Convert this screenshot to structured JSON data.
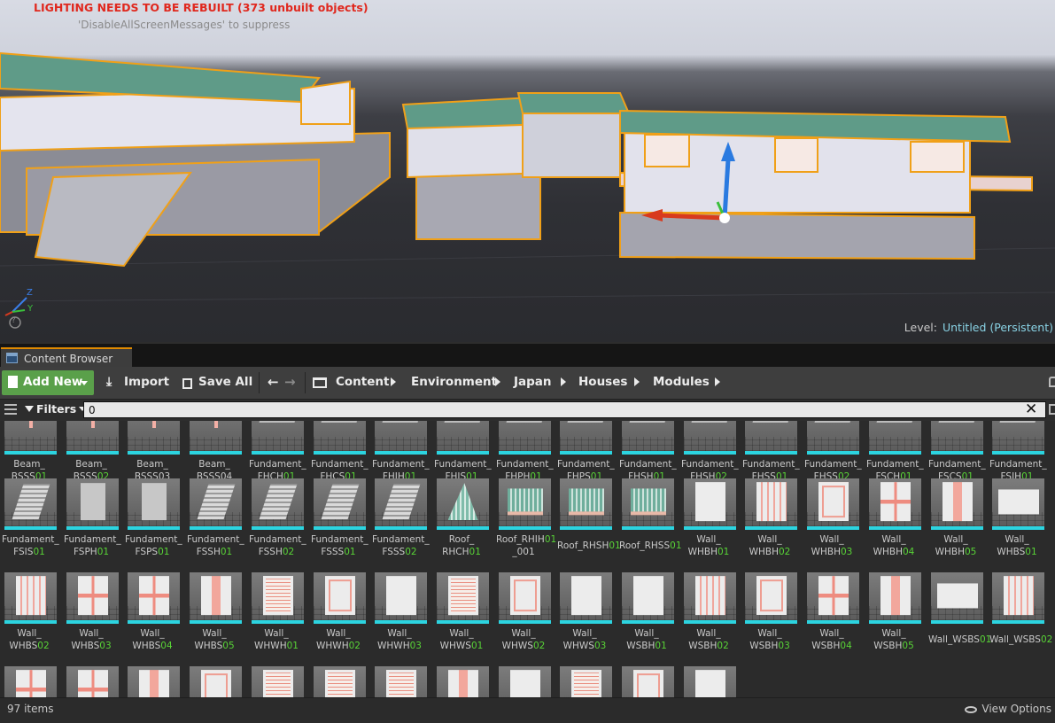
{
  "viewport": {
    "warning": "LIGHTING NEEDS TO BE REBUILT (373 unbuilt objects)",
    "warning_hint": "'DisableAllScreenMessages' to suppress",
    "level_label": "Level:",
    "level_value": "Untitled (Persistent)",
    "axis_z": "Z",
    "axis_y": "Y",
    "help": "?"
  },
  "tab": {
    "label": "Content Browser"
  },
  "toolbar": {
    "add_new": "Add New",
    "import": "Import",
    "save_all": "Save All",
    "back": "←",
    "forward": "→",
    "breadcrumbs": [
      "Content",
      "Environment",
      "Japan",
      "Houses",
      "Modules"
    ]
  },
  "filter": {
    "label": "Filters",
    "search_value": "0",
    "clear": "✕"
  },
  "assets": {
    "rows": [
      [
        {
          "pre": "Beam_",
          "mid": "BSSS",
          "hl": "01",
          "post": "",
          "kind": "beam"
        },
        {
          "pre": "Beam_",
          "mid": "BSSS",
          "hl": "02",
          "post": "",
          "kind": "beam"
        },
        {
          "pre": "Beam_",
          "mid": "BSSS03",
          "hl": "",
          "post": "",
          "kind": "beam"
        },
        {
          "pre": "Beam_",
          "mid": "BSSS04",
          "hl": "",
          "post": "",
          "kind": "beam"
        },
        {
          "pre": "Fundament_",
          "mid": "FHCH",
          "hl": "01",
          "post": "",
          "kind": "fund"
        },
        {
          "pre": "Fundament_",
          "mid": "FHCS",
          "hl": "01",
          "post": "",
          "kind": "fund"
        },
        {
          "pre": "Fundament_",
          "mid": "FHIH",
          "hl": "01",
          "post": "",
          "kind": "fund"
        },
        {
          "pre": "Fundament_",
          "mid": "FHIS",
          "hl": "01",
          "post": "",
          "kind": "fund"
        },
        {
          "pre": "Fundament_",
          "mid": "FHPH",
          "hl": "01",
          "post": "",
          "kind": "fund"
        },
        {
          "pre": "Fundament_",
          "mid": "FHPS",
          "hl": "01",
          "post": "",
          "kind": "fund"
        },
        {
          "pre": "Fundament_",
          "mid": "FHSH",
          "hl": "01",
          "post": "",
          "kind": "fund"
        },
        {
          "pre": "Fundament_",
          "mid": "FHSH",
          "hl": "02",
          "post": "",
          "kind": "fund"
        },
        {
          "pre": "Fundament_",
          "mid": "FHSS",
          "hl": "01",
          "post": "",
          "kind": "fund"
        },
        {
          "pre": "Fundament_",
          "mid": "FHSS",
          "hl": "02",
          "post": "",
          "kind": "fund"
        },
        {
          "pre": "Fundament_",
          "mid": "FSCH",
          "hl": "01",
          "post": "",
          "kind": "fund"
        },
        {
          "pre": "Fundament_",
          "mid": "FSCS",
          "hl": "01",
          "post": "",
          "kind": "fund"
        },
        {
          "pre": "Fundament_",
          "mid": "FSIH",
          "hl": "01",
          "post": "",
          "kind": "fund"
        }
      ],
      [
        {
          "pre": "Fundament_",
          "mid": "FSIS",
          "hl": "01",
          "post": "",
          "kind": "stair"
        },
        {
          "pre": "Fundament_",
          "mid": "FSPH",
          "hl": "01",
          "post": "",
          "kind": "stone"
        },
        {
          "pre": "Fundament_",
          "mid": "FSPS",
          "hl": "01",
          "post": "",
          "kind": "stone"
        },
        {
          "pre": "Fundament_",
          "mid": "FSSH",
          "hl": "01",
          "post": "",
          "kind": "stair"
        },
        {
          "pre": "Fundament_",
          "mid": "FSSH",
          "hl": "02",
          "post": "",
          "kind": "stair"
        },
        {
          "pre": "Fundament_",
          "mid": "FSSS",
          "hl": "01",
          "post": "",
          "kind": "stair"
        },
        {
          "pre": "Fundament_",
          "mid": "FSSS",
          "hl": "02",
          "post": "",
          "kind": "stair"
        },
        {
          "pre": "Roof_",
          "mid": "RHCH",
          "hl": "01",
          "post": "",
          "kind": "roof-peak"
        },
        {
          "pre": "Roof_RHIH",
          "mid": "",
          "hl": "01",
          "post": "_001",
          "kind": "roof",
          "prehl": true
        },
        {
          "pre": "",
          "mid": "Roof_RHSH",
          "hl": "01",
          "post": "",
          "kind": "roof",
          "oneline": true
        },
        {
          "pre": "",
          "mid": "Roof_RHSS",
          "hl": "01",
          "post": "",
          "kind": "roof",
          "oneline": true
        },
        {
          "pre": "Wall_",
          "mid": "WHBH",
          "hl": "01",
          "post": "",
          "kind": "wall"
        },
        {
          "pre": "Wall_",
          "mid": "WHBH",
          "hl": "02",
          "post": "",
          "kind": "pillars"
        },
        {
          "pre": "Wall_",
          "mid": "WHBH",
          "hl": "03",
          "post": "",
          "kind": "frame"
        },
        {
          "pre": "Wall_",
          "mid": "WHBH",
          "hl": "04",
          "post": "",
          "kind": "cross"
        },
        {
          "pre": "Wall_",
          "mid": "WHBH",
          "hl": "05",
          "post": "",
          "kind": "redcol"
        },
        {
          "pre": "Wall_",
          "mid": "WHBS",
          "hl": "01",
          "post": "",
          "kind": "wide"
        }
      ],
      [
        {
          "pre": "Wall_",
          "mid": "WHBS",
          "hl": "02",
          "post": "",
          "kind": "pillars"
        },
        {
          "pre": "Wall_",
          "mid": "WHBS",
          "hl": "03",
          "post": "",
          "kind": "cross"
        },
        {
          "pre": "Wall_",
          "mid": "WHBS",
          "hl": "04",
          "post": "",
          "kind": "cross"
        },
        {
          "pre": "Wall_",
          "mid": "WHBS",
          "hl": "05",
          "post": "",
          "kind": "redcol"
        },
        {
          "pre": "Wall_",
          "mid": "WHWH",
          "hl": "01",
          "post": "",
          "kind": "lattice"
        },
        {
          "pre": "Wall_",
          "mid": "WHWH",
          "hl": "02",
          "post": "",
          "kind": "frame"
        },
        {
          "pre": "Wall_",
          "mid": "WHWH",
          "hl": "03",
          "post": "",
          "kind": "wall"
        },
        {
          "pre": "Wall_",
          "mid": "WHWS",
          "hl": "01",
          "post": "",
          "kind": "lattice"
        },
        {
          "pre": "Wall_",
          "mid": "WHWS",
          "hl": "02",
          "post": "",
          "kind": "frame"
        },
        {
          "pre": "Wall_",
          "mid": "WHWS",
          "hl": "03",
          "post": "",
          "kind": "wall"
        },
        {
          "pre": "Wall_",
          "mid": "WSBH",
          "hl": "01",
          "post": "",
          "kind": "wall"
        },
        {
          "pre": "Wall_",
          "mid": "WSBH",
          "hl": "02",
          "post": "",
          "kind": "pillars"
        },
        {
          "pre": "Wall_",
          "mid": "WSBH",
          "hl": "03",
          "post": "",
          "kind": "frame"
        },
        {
          "pre": "Wall_",
          "mid": "WSBH",
          "hl": "04",
          "post": "",
          "kind": "cross"
        },
        {
          "pre": "Wall_",
          "mid": "WSBH",
          "hl": "05",
          "post": "",
          "kind": "redcol"
        },
        {
          "pre": "",
          "mid": "Wall_WSBS",
          "hl": "01",
          "post": "",
          "kind": "wide",
          "oneline": true
        },
        {
          "pre": "",
          "mid": "Wall_WSBS",
          "hl": "02",
          "post": "",
          "kind": "pillars",
          "oneline": true
        }
      ],
      [
        {
          "kind": "cross"
        },
        {
          "kind": "cross"
        },
        {
          "kind": "redcol"
        },
        {
          "kind": "frame"
        },
        {
          "kind": "lattice"
        },
        {
          "kind": "lattice"
        },
        {
          "kind": "lattice"
        },
        {
          "kind": "redcol"
        },
        {
          "kind": "wall"
        },
        {
          "kind": "lattice"
        },
        {
          "kind": "frame"
        },
        {
          "kind": "wall"
        }
      ]
    ]
  },
  "status": {
    "item_count": "97 items",
    "view_options": "View Options"
  },
  "colors": {
    "accent_selection": "#2cd4e0",
    "add_new_green": "#5aa04a",
    "warning_red": "#e0281e",
    "highlight_green": "#58d336",
    "level_value": "#8ad4e6",
    "outline_orange": "#f0a018"
  }
}
